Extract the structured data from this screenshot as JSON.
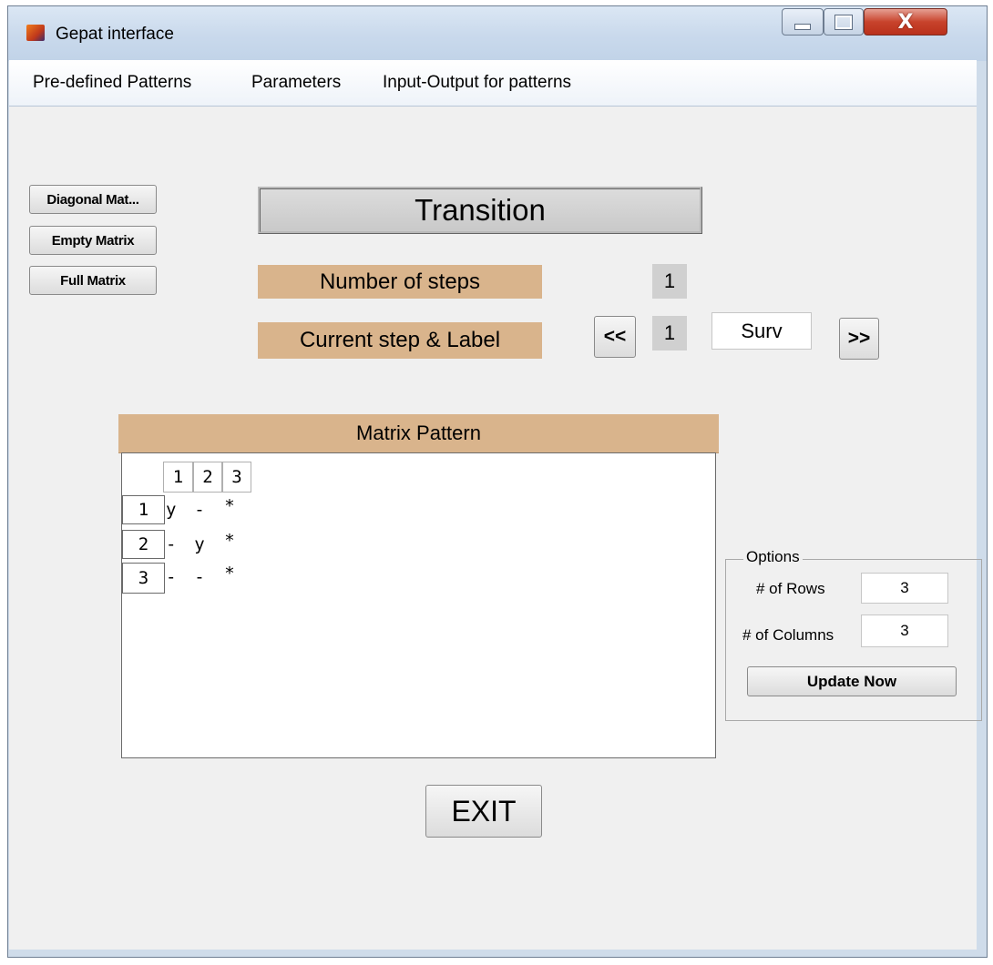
{
  "window": {
    "title": "Gepat interface",
    "controls": {
      "minimize": "minimize-icon",
      "maximize": "maximize-icon",
      "close": "X"
    }
  },
  "menu": {
    "items": [
      "Pre-defined Patterns",
      "Parameters",
      "Input-Output for patterns"
    ]
  },
  "side_buttons": [
    "Diagonal Mat...",
    "Empty Matrix",
    "Full Matrix"
  ],
  "transition_label": "Transition",
  "steps": {
    "number_label": "Number of steps",
    "number_value": "1",
    "current_label": "Current step & Label",
    "prev_label": "<<",
    "current_value": "1",
    "step_label_value": "Surv",
    "next_label": ">>"
  },
  "matrix": {
    "title": "Matrix Pattern",
    "col_headers": [
      "1",
      "2",
      "3"
    ],
    "rows": [
      {
        "header": "1",
        "cells": [
          "y",
          "-",
          "*"
        ]
      },
      {
        "header": "2",
        "cells": [
          "-",
          "y",
          "*"
        ]
      },
      {
        "header": "3",
        "cells": [
          "-",
          "-",
          "*"
        ]
      }
    ]
  },
  "options": {
    "legend": "Options",
    "rows_label": "# of Rows",
    "rows_value": "3",
    "cols_label": "# of Columns",
    "cols_value": "3",
    "update_label": "Update Now"
  },
  "exit_label": "EXIT",
  "colors": {
    "tan": "#d9b48c",
    "grey": "#d0d0d0",
    "client": "#f0f0f0"
  }
}
